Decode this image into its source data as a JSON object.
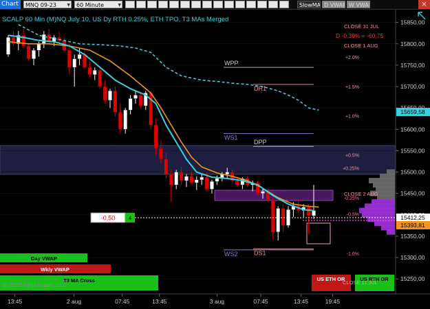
{
  "toolbar": {
    "tab_label": "Chart",
    "instrument": "MNQ 09-23",
    "interval": "60 Minute",
    "button1": "SlowMA",
    "button2": "D VWAP",
    "button3": "W VWAP"
  },
  "chart_title": "SCALP 60 Min (M)NQ July 10, US Dy RTH 0.25%, ETH TPO, T3 MAs Merged",
  "colors": {
    "background": "#000000",
    "bull_candle": "#ffffff",
    "bear_candle": "#e00000",
    "ma_cyan": "#39d0e0",
    "ma_orange": "#f0941e",
    "dashed_ma": "#39d0e0",
    "ws_zone": "#1e1e40",
    "volume_profile": "#9b30d8"
  },
  "chart_data": {
    "type": "candlestick",
    "y_axis": {
      "min": 15215,
      "max": 15880,
      "ticks": [
        15850,
        15800,
        15750,
        15700,
        15650,
        15600,
        15550,
        15500,
        15450,
        15400,
        15350,
        15300,
        15250
      ],
      "tick_labels": [
        "15850,00",
        "15800,00",
        "15750,00",
        "15700,00",
        "15650,00",
        "15600,00",
        "15550,00",
        "15500,00",
        "15450,00",
        "15400,00",
        "15350,00",
        "15300,00",
        "15250,00"
      ]
    },
    "x_axis": {
      "tick_labels": [
        "13:45",
        "2 aug",
        "07:45",
        "13:45",
        "3 aug",
        "07:45",
        "13:45",
        "19:45"
      ]
    },
    "candles": [
      {
        "o": 15775,
        "h": 15820,
        "l": 15770,
        "c": 15815
      },
      {
        "o": 15815,
        "h": 15830,
        "l": 15795,
        "c": 15800
      },
      {
        "o": 15800,
        "h": 15830,
        "l": 15785,
        "c": 15820
      },
      {
        "o": 15820,
        "h": 15835,
        "l": 15790,
        "c": 15795
      },
      {
        "o": 15795,
        "h": 15800,
        "l": 15760,
        "c": 15765
      },
      {
        "o": 15765,
        "h": 15790,
        "l": 15750,
        "c": 15785
      },
      {
        "o": 15785,
        "h": 15805,
        "l": 15770,
        "c": 15800
      },
      {
        "o": 15800,
        "h": 15830,
        "l": 15790,
        "c": 15822
      },
      {
        "o": 15822,
        "h": 15835,
        "l": 15800,
        "c": 15805
      },
      {
        "o": 15805,
        "h": 15820,
        "l": 15795,
        "c": 15815
      },
      {
        "o": 15815,
        "h": 15828,
        "l": 15802,
        "c": 15808
      },
      {
        "o": 15808,
        "h": 15815,
        "l": 15780,
        "c": 15785
      },
      {
        "o": 15785,
        "h": 15800,
        "l": 15730,
        "c": 15745
      },
      {
        "o": 15745,
        "h": 15775,
        "l": 15700,
        "c": 15765
      },
      {
        "o": 15765,
        "h": 15790,
        "l": 15750,
        "c": 15775
      },
      {
        "o": 15775,
        "h": 15785,
        "l": 15740,
        "c": 15745
      },
      {
        "o": 15745,
        "h": 15760,
        "l": 15720,
        "c": 15728
      },
      {
        "o": 15728,
        "h": 15745,
        "l": 15715,
        "c": 15738
      },
      {
        "o": 15738,
        "h": 15745,
        "l": 15695,
        "c": 15700
      },
      {
        "o": 15700,
        "h": 15715,
        "l": 15660,
        "c": 15668
      },
      {
        "o": 15668,
        "h": 15695,
        "l": 15650,
        "c": 15690
      },
      {
        "o": 15690,
        "h": 15700,
        "l": 15630,
        "c": 15640
      },
      {
        "o": 15640,
        "h": 15660,
        "l": 15590,
        "c": 15600
      },
      {
        "o": 15600,
        "h": 15650,
        "l": 15590,
        "c": 15645
      },
      {
        "o": 15645,
        "h": 15680,
        "l": 15635,
        "c": 15672
      },
      {
        "o": 15672,
        "h": 15690,
        "l": 15660,
        "c": 15680
      },
      {
        "o": 15680,
        "h": 15688,
        "l": 15650,
        "c": 15655
      },
      {
        "o": 15655,
        "h": 15690,
        "l": 15645,
        "c": 15685
      },
      {
        "o": 15685,
        "h": 15690,
        "l": 15600,
        "c": 15610
      },
      {
        "o": 15610,
        "h": 15625,
        "l": 15540,
        "c": 15555
      },
      {
        "o": 15555,
        "h": 15575,
        "l": 15520,
        "c": 15530
      },
      {
        "o": 15530,
        "h": 15545,
        "l": 15485,
        "c": 15495
      },
      {
        "o": 15495,
        "h": 15505,
        "l": 15430,
        "c": 15470
      },
      {
        "o": 15470,
        "h": 15505,
        "l": 15460,
        "c": 15500
      },
      {
        "o": 15500,
        "h": 15512,
        "l": 15470,
        "c": 15480
      },
      {
        "o": 15480,
        "h": 15495,
        "l": 15465,
        "c": 15490
      },
      {
        "o": 15490,
        "h": 15500,
        "l": 15470,
        "c": 15475
      },
      {
        "o": 15475,
        "h": 15490,
        "l": 15458,
        "c": 15482
      },
      {
        "o": 15482,
        "h": 15495,
        "l": 15470,
        "c": 15488
      },
      {
        "o": 15488,
        "h": 15500,
        "l": 15455,
        "c": 15460
      },
      {
        "o": 15460,
        "h": 15482,
        "l": 15450,
        "c": 15478
      },
      {
        "o": 15478,
        "h": 15492,
        "l": 15470,
        "c": 15485
      },
      {
        "o": 15485,
        "h": 15500,
        "l": 15478,
        "c": 15495
      },
      {
        "o": 15495,
        "h": 15510,
        "l": 15485,
        "c": 15500
      },
      {
        "o": 15500,
        "h": 15506,
        "l": 15475,
        "c": 15480
      },
      {
        "o": 15480,
        "h": 15490,
        "l": 15465,
        "c": 15470
      },
      {
        "o": 15470,
        "h": 15488,
        "l": 15460,
        "c": 15485
      },
      {
        "o": 15485,
        "h": 15492,
        "l": 15465,
        "c": 15470
      },
      {
        "o": 15470,
        "h": 15480,
        "l": 15455,
        "c": 15475
      },
      {
        "o": 15475,
        "h": 15480,
        "l": 15445,
        "c": 15450
      },
      {
        "o": 15450,
        "h": 15462,
        "l": 15438,
        "c": 15455
      },
      {
        "o": 15455,
        "h": 15462,
        "l": 15430,
        "c": 15435
      },
      {
        "o": 15435,
        "h": 15440,
        "l": 15345,
        "c": 15360
      },
      {
        "o": 15360,
        "h": 15420,
        "l": 15340,
        "c": 15415
      },
      {
        "o": 15415,
        "h": 15425,
        "l": 15360,
        "c": 15375
      },
      {
        "o": 15375,
        "h": 15420,
        "l": 15370,
        "c": 15412
      },
      {
        "o": 15412,
        "h": 15430,
        "l": 15395,
        "c": 15420
      },
      {
        "o": 15420,
        "h": 15432,
        "l": 15405,
        "c": 15410
      },
      {
        "o": 15410,
        "h": 15425,
        "l": 15395,
        "c": 15418
      },
      {
        "o": 15418,
        "h": 15425,
        "l": 15355,
        "c": 15398
      },
      {
        "o": 15398,
        "h": 15470,
        "l": 15390,
        "c": 15410
      }
    ],
    "ma_cyan": [
      [
        0,
        15820
      ],
      [
        3,
        15815
      ],
      [
        6,
        15808
      ],
      [
        9,
        15805
      ],
      [
        12,
        15795
      ],
      [
        15,
        15775
      ],
      [
        18,
        15745
      ],
      [
        21,
        15715
      ],
      [
        24,
        15695
      ],
      [
        27,
        15680
      ],
      [
        29,
        15660
      ],
      [
        31,
        15610
      ],
      [
        33,
        15570
      ],
      [
        35,
        15530
      ],
      [
        37,
        15500
      ],
      [
        40,
        15488
      ],
      [
        43,
        15485
      ],
      [
        46,
        15480
      ],
      [
        49,
        15470
      ],
      [
        52,
        15445
      ],
      [
        55,
        15425
      ],
      [
        58,
        15412
      ],
      [
        60,
        15410
      ]
    ],
    "ma_orange": [
      [
        0,
        15805
      ],
      [
        4,
        15800
      ],
      [
        8,
        15800
      ],
      [
        12,
        15795
      ],
      [
        16,
        15785
      ],
      [
        20,
        15760
      ],
      [
        24,
        15725
      ],
      [
        28,
        15685
      ],
      [
        30,
        15650
      ],
      [
        32,
        15610
      ],
      [
        34,
        15570
      ],
      [
        36,
        15535
      ],
      [
        38,
        15512
      ],
      [
        41,
        15498
      ],
      [
        44,
        15490
      ],
      [
        47,
        15480
      ],
      [
        50,
        15462
      ],
      [
        53,
        15440
      ],
      [
        56,
        15425
      ],
      [
        59,
        15420
      ],
      [
        61,
        15418
      ]
    ],
    "ma_dashed": [
      [
        2,
        15845
      ],
      [
        6,
        15820
      ],
      [
        10,
        15810
      ],
      [
        14,
        15800
      ],
      [
        18,
        15798
      ],
      [
        22,
        15795
      ],
      [
        25,
        15790
      ],
      [
        28,
        15780
      ],
      [
        31,
        15745
      ],
      [
        34,
        15725
      ],
      [
        38,
        15715
      ],
      [
        41,
        15712
      ],
      [
        44,
        15708
      ],
      [
        47,
        15705
      ],
      [
        50,
        15700
      ],
      [
        53,
        15690
      ],
      [
        55,
        15680
      ],
      [
        57,
        15668
      ],
      [
        59,
        15650
      ],
      [
        61,
        15645
      ]
    ],
    "levels": [
      {
        "label": "WPP",
        "price": 15745,
        "color": "#cccccc"
      },
      {
        "label": "DR1",
        "price": 15705,
        "color": "#e89aa0"
      },
      {
        "label": "WS1",
        "price": 15590,
        "color": "#8a7ad8"
      },
      {
        "label": "DPP",
        "price": 15560,
        "color": "#cccccc"
      },
      {
        "label": "WS2",
        "price": 15318,
        "color": "#8a7ad8"
      },
      {
        "label": "DS1",
        "price": 15320,
        "color": "#e89aa0"
      }
    ],
    "pct_labels": [
      {
        "text": "+2.0%",
        "price": 15769
      },
      {
        "text": "+1.5%",
        "price": 15700
      },
      {
        "text": "+1.0%",
        "price": 15632
      },
      {
        "text": "+0.5%",
        "price": 15540
      },
      {
        "text": "+0.25%",
        "price": 15510
      },
      {
        "text": "-0.25%",
        "price": 15440
      },
      {
        "text": "-0.5%",
        "price": 15402
      },
      {
        "text": "-1.0%",
        "price": 15310
      }
    ],
    "close_labels": {
      "close_31": "CLOSE 31 JUL",
      "diff": "D -0,39% = -60,75",
      "close_1": "CLOSE 1 AUG",
      "close_2": "CLOSE 2 AUG",
      "close_11": "CLOSE 11 JUL"
    },
    "price_tags": {
      "current": "15412,25",
      "upper": "15659,58",
      "lower": "15393,81"
    },
    "order_line": {
      "price": 15412.25,
      "pnl": "-0,50",
      "qty": "4"
    },
    "volume_profile": [
      {
        "price": 15500,
        "len": 12
      },
      {
        "price": 15490,
        "len": 22
      },
      {
        "price": 15480,
        "len": 38
      },
      {
        "price": 15470,
        "len": 32
      },
      {
        "price": 15460,
        "len": 28
      },
      {
        "price": 15450,
        "len": 36
      },
      {
        "price": 15440,
        "len": 26
      },
      {
        "price": 15430,
        "len": 34
      },
      {
        "price": 15420,
        "len": 44
      },
      {
        "price": 15410,
        "len": 52
      },
      {
        "price": 15400,
        "len": 48
      },
      {
        "price": 15390,
        "len": 40
      },
      {
        "price": 15380,
        "len": 30
      },
      {
        "price": 15370,
        "len": 20
      },
      {
        "price": 15360,
        "len": 12
      }
    ]
  },
  "legend_buttons": {
    "day_vwap": "Day VWAP",
    "wkly_vwap": "Wkly VWAP",
    "t3_ma": "T3 MA Cross",
    "copyright": "© 2023 NinjaTrader, LLC",
    "us_eth": "US ETH OR",
    "us_rth": "US RTH OR"
  }
}
